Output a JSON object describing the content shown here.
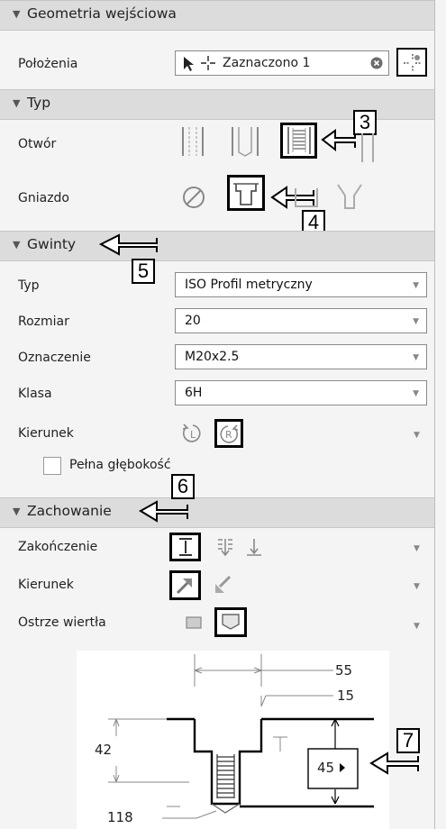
{
  "geometry": {
    "title": "Geometria wejściowa",
    "positions_label": "Położenia",
    "positions_value": "Zaznaczono 1"
  },
  "type_section": {
    "title": "Typ",
    "hole_label": "Otwór",
    "seat_label": "Gniazdo"
  },
  "threads": {
    "title": "Gwinty",
    "type_label": "Typ",
    "type_value": "ISO Profil metryczny",
    "size_label": "Rozmiar",
    "size_value": "20",
    "designation_label": "Oznaczenie",
    "designation_value": "M20x2.5",
    "class_label": "Klasa",
    "class_value": "6H",
    "direction_label": "Kierunek",
    "full_depth_label": "Pełna głębokość",
    "full_depth_checked": false
  },
  "behavior": {
    "title": "Zachowanie",
    "termination_label": "Zakończenie",
    "direction_label": "Kierunek",
    "drill_point_label": "Ostrze wiertła"
  },
  "preview": {
    "dim_55": "55",
    "dim_15": "15",
    "dim_42": "42",
    "dim_45": "45",
    "dim_118": "118"
  },
  "callouts": [
    "3",
    "4",
    "5",
    "6",
    "7"
  ],
  "icons": {
    "collapse": "triangle-down-icon",
    "cursor": "arrow-cursor-icon",
    "crosshair": "crosshair-icon",
    "clear": "clear-circle-icon",
    "point_picker": "point-picker-icon",
    "dropdown": "chevron-down-icon"
  }
}
